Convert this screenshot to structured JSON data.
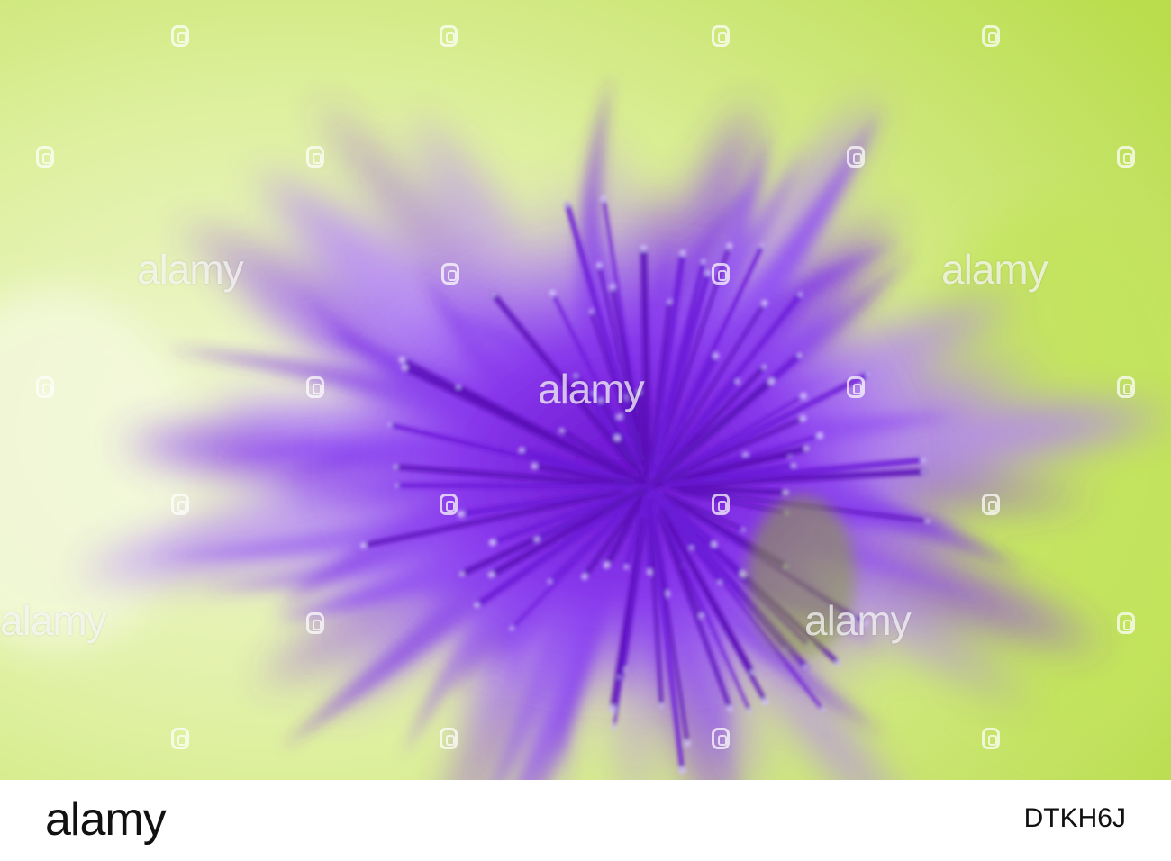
{
  "photo": {
    "subject": "purple-cornflower-macro",
    "colors": {
      "petal": "#8a3df0",
      "petal_light": "#b07cff",
      "center": "#6a1bd6",
      "background_green": "#c8e86a",
      "background_light": "#eef7cf"
    }
  },
  "watermark": {
    "text": "alamy",
    "logo_icon": "alamy-logo-icon"
  },
  "footer": {
    "logo": "alamy",
    "image_id": "DTKH6J"
  }
}
